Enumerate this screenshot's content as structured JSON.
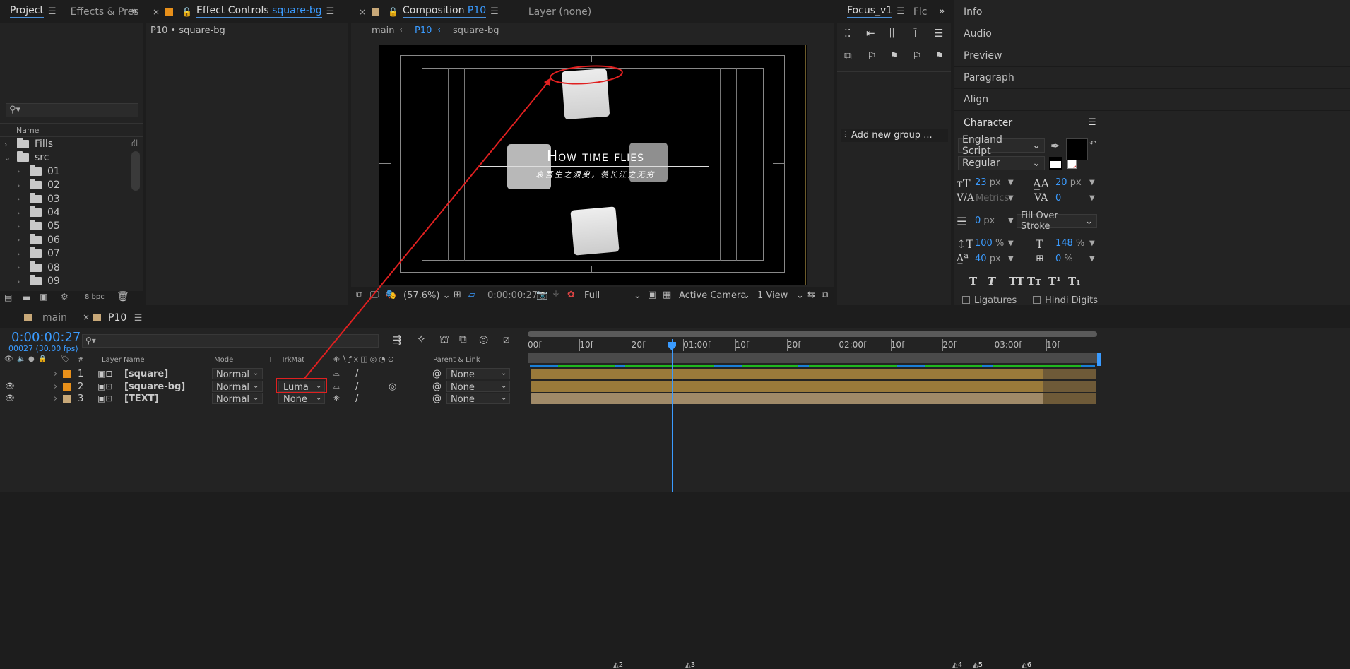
{
  "project": {
    "tab1": "Project",
    "tab2": "Effects & Pres",
    "search_placeholder": "",
    "col_name": "Name",
    "bpc": "8 bpc",
    "tree": [
      {
        "label": "Fills",
        "indent": 0,
        "open": false
      },
      {
        "label": "src",
        "indent": 0,
        "open": true
      },
      {
        "label": "01",
        "indent": 1
      },
      {
        "label": "02",
        "indent": 1
      },
      {
        "label": "03",
        "indent": 1
      },
      {
        "label": "04",
        "indent": 1
      },
      {
        "label": "05",
        "indent": 1
      },
      {
        "label": "06",
        "indent": 1
      },
      {
        "label": "07",
        "indent": 1
      },
      {
        "label": "08",
        "indent": 1
      },
      {
        "label": "09",
        "indent": 1
      }
    ]
  },
  "effect": {
    "tab_prefix": "Effect Controls",
    "tab_name": "square-bg",
    "sub": "P10 • square-bg"
  },
  "comp": {
    "tab_prefix": "Composition",
    "tab_name": "P10",
    "layer_tab": "Layer  (none)",
    "bc_main": "main",
    "bc_p10": "P10",
    "bc_layer": "square-bg",
    "title_text": "How time flies",
    "subtitle_text": "哀吾生之须臾，羡长江之无穷",
    "zoom": "(57.6%)",
    "time": "0:00:00:27",
    "res": "Full",
    "camera": "Active Camera",
    "views": "1 View"
  },
  "focus": {
    "tab": "Focus_v1",
    "tab2": "Flc",
    "add_group": "Add new group ..."
  },
  "right": {
    "items": [
      "Info",
      "Audio",
      "Preview",
      "Paragraph",
      "Align"
    ],
    "character": "Character",
    "font": "England Script",
    "style": "Regular",
    "size": "23",
    "size_unit": "px",
    "leading": "20",
    "leading_unit": "px",
    "kerning": "Metrics",
    "tracking": "0",
    "stroke": "0",
    "stroke_unit": "px",
    "stroke_mode": "Fill Over Stroke",
    "vscale": "100",
    "hscale": "148",
    "pct": "%",
    "baseline": "40",
    "baseline_unit": "px",
    "tsume": "0",
    "ligatures": "Ligatures",
    "hindi": "Hindi Digits"
  },
  "timeline": {
    "tab_main": "main",
    "tab_p10": "P10",
    "time": "0:00:00:27",
    "frames": "00027 (30.00 fps)",
    "cols": {
      "num": "#",
      "name": "Layer Name",
      "mode": "Mode",
      "t": "T",
      "trkmat": "TrkMat",
      "parent": "Parent & Link"
    },
    "layers": [
      {
        "num": "1",
        "name": "[square]",
        "mode": "Normal",
        "trk": "",
        "parent": "None",
        "color": "#e8901a"
      },
      {
        "num": "2",
        "name": "[square-bg]",
        "mode": "Normal",
        "trk": "Luma",
        "parent": "None",
        "color": "#e8901a"
      },
      {
        "num": "3",
        "name": "[TEXT]",
        "mode": "Normal",
        "trk": "None",
        "parent": "None",
        "color": "#c8a878"
      }
    ],
    "ruler": [
      "00f",
      "10f",
      "20f",
      "01:00f",
      "10f",
      "20f",
      "02:00f",
      "10f",
      "20f",
      "03:00f",
      "10f"
    ],
    "markers": [
      "2",
      "3",
      "4",
      "5",
      "6"
    ]
  },
  "colors": {
    "accent": "#3a9bff",
    "annotation": "#e02020",
    "bar": "#9a7a3a"
  }
}
